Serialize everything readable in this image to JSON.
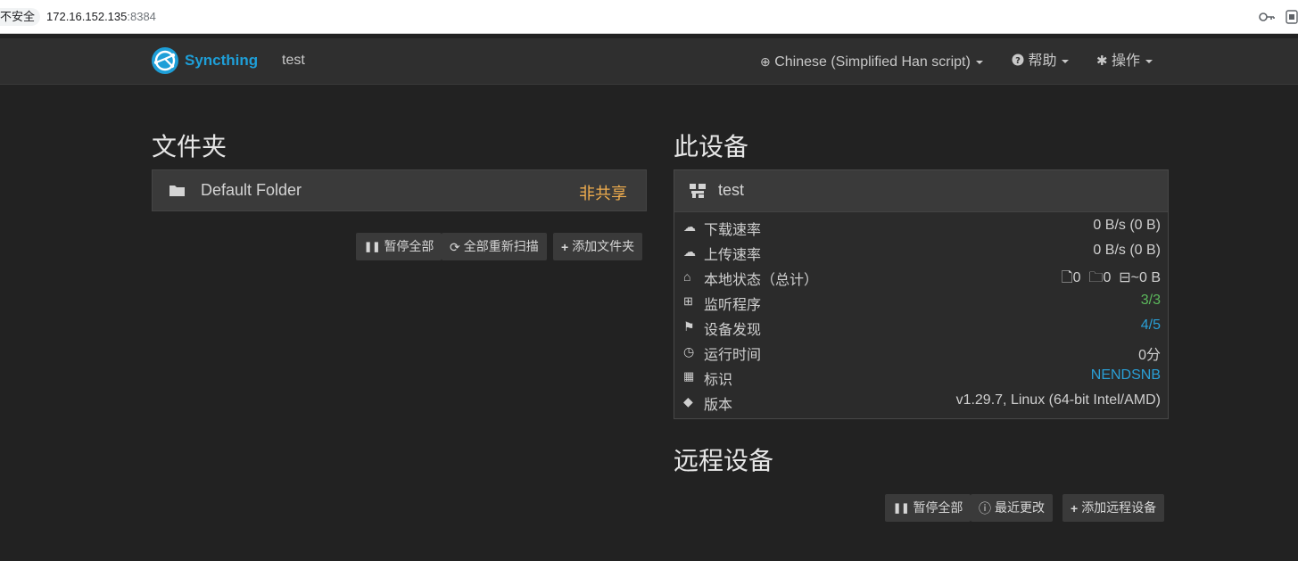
{
  "browser": {
    "security_label": "不安全",
    "url_host": "172.16.152.135",
    "url_port": ":8384"
  },
  "navbar": {
    "brand": "Syncthing",
    "device_name": "test",
    "language": "Chinese (Simplified Han script)",
    "help": "帮助",
    "actions": "操作"
  },
  "folders": {
    "heading": "文件夹",
    "items": [
      {
        "label": "Default Folder",
        "status": "非共享"
      }
    ],
    "buttons": {
      "pause_all": "暂停全部",
      "rescan_all": "全部重新扫描",
      "add_folder": "添加文件夹"
    }
  },
  "this_device": {
    "heading": "此设备",
    "name": "test",
    "rows": {
      "download_rate": {
        "label": "下载速率",
        "value": "0 B/s (0 B)"
      },
      "upload_rate": {
        "label": "上传速率",
        "value": "0 B/s (0 B)"
      },
      "local_state": {
        "label": "本地状态（总计）",
        "files": "0",
        "dirs": "0",
        "size": "~0 B"
      },
      "listeners": {
        "label": "监听程序",
        "value": "3/3"
      },
      "discovery": {
        "label": "设备发现",
        "value": "4/5"
      },
      "uptime": {
        "label": "运行时间",
        "value": "0分"
      },
      "identity": {
        "label": "标识",
        "value": "NENDSNB"
      },
      "version": {
        "label": "版本",
        "value": "v1.29.7, Linux (64-bit Intel/AMD)"
      }
    }
  },
  "remote_devices": {
    "heading": "远程设备",
    "buttons": {
      "pause_all": "暂停全部",
      "recent_changes": "最近更改",
      "add_remote": "添加远程设备"
    }
  },
  "colors": {
    "background": "#222222",
    "navbar": "#2f2f2f",
    "brand": "#1e9fd8",
    "warning": "#f0ad4e",
    "success": "#5cb85c",
    "link": "#2a9fd6"
  }
}
